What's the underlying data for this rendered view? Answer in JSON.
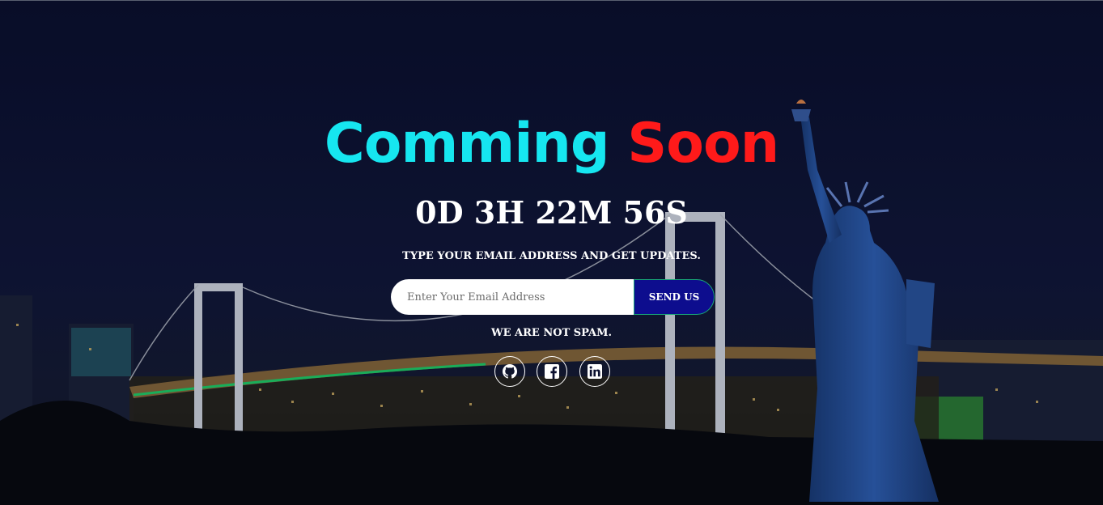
{
  "hero": {
    "title_word1": "Comming",
    "title_word2": "Soon",
    "countdown": "0D 3H 22M 56S",
    "subtitle": "TYPE YOUR EMAIL ADDRESS AND GET UPDATES.",
    "note": "WE ARE NOT SPAM."
  },
  "subscribe": {
    "email_placeholder": "Enter Your Email Address",
    "email_value": "",
    "button_label": "SEND US"
  },
  "socials": [
    {
      "icon": "github-icon"
    },
    {
      "icon": "facebook-icon"
    },
    {
      "icon": "linkedin-icon"
    }
  ],
  "colors": {
    "title_word1": "#16e6f0",
    "title_word2": "#ff1a1a",
    "button_bg": "#0d0d8e",
    "background": "#0b1030"
  }
}
